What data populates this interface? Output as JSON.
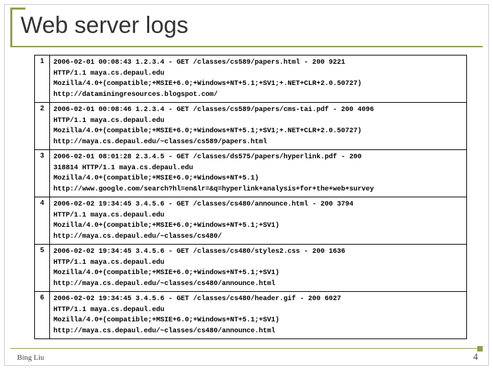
{
  "title": "Web server logs",
  "author": "Bing Liu",
  "page_number": "4",
  "logs": [
    {
      "n": "1",
      "lines": [
        "2006-02-01 00:08:43 1.2.3.4 - GET /classes/cs589/papers.html - 200 9221",
        "HTTP/1.1 maya.cs.depaul.edu",
        "Mozilla/4.0+(compatible;+MSIE+6.0;+Windows+NT+5.1;+SV1;+.NET+CLR+2.0.50727)",
        "http://dataminingresources.blogspot.com/"
      ]
    },
    {
      "n": "2",
      "lines": [
        "2006-02-01 00:08:46 1.2.3.4 - GET /classes/cs589/papers/cms-tai.pdf - 200 4096",
        "HTTP/1.1 maya.cs.depaul.edu",
        "Mozilla/4.0+(compatible;+MSIE+6.0;+Windows+NT+5.1;+SV1;+.NET+CLR+2.0.50727)",
        "http://maya.cs.depaul.edu/~classes/cs589/papers.html"
      ]
    },
    {
      "n": "3",
      "lines": [
        "2006-02-01 08:01:28 2.3.4.5 - GET /classes/ds575/papers/hyperlink.pdf - 200",
        "318814 HTTP/1.1 maya.cs.depaul.edu",
        "Mozilla/4.0+(compatible;+MSIE+6.0;+Windows+NT+5.1)",
        "http://www.google.com/search?hl=en&lr=&q=hyperlink+analysis+for+the+web+survey"
      ]
    },
    {
      "n": "4",
      "lines": [
        "2006-02-02 19:34:45 3.4.5.6 - GET /classes/cs480/announce.html - 200 3794",
        "HTTP/1.1 maya.cs.depaul.edu",
        "Mozilla/4.0+(compatible;+MSIE+6.0;+Windows+NT+5.1;+SV1)",
        "http://maya.cs.depaul.edu/~classes/cs480/"
      ]
    },
    {
      "n": "5",
      "lines": [
        "2006-02-02 19:34:45 3.4.5.6 - GET /classes/cs480/styles2.css - 200 1636",
        "HTTP/1.1 maya.cs.depaul.edu",
        "Mozilla/4.0+(compatible;+MSIE+6.0;+Windows+NT+5.1;+SV1)",
        "http://maya.cs.depaul.edu/~classes/cs480/announce.html"
      ]
    },
    {
      "n": "6",
      "lines": [
        "2006-02-02 19:34:45 3.4.5.6 - GET /classes/cs480/header.gif - 200 6027",
        "HTTP/1.1 maya.cs.depaul.edu",
        "Mozilla/4.0+(compatible;+MSIE+6.0;+Windows+NT+5.1;+SV1)",
        "http://maya.cs.depaul.edu/~classes/cs480/announce.html"
      ]
    }
  ]
}
